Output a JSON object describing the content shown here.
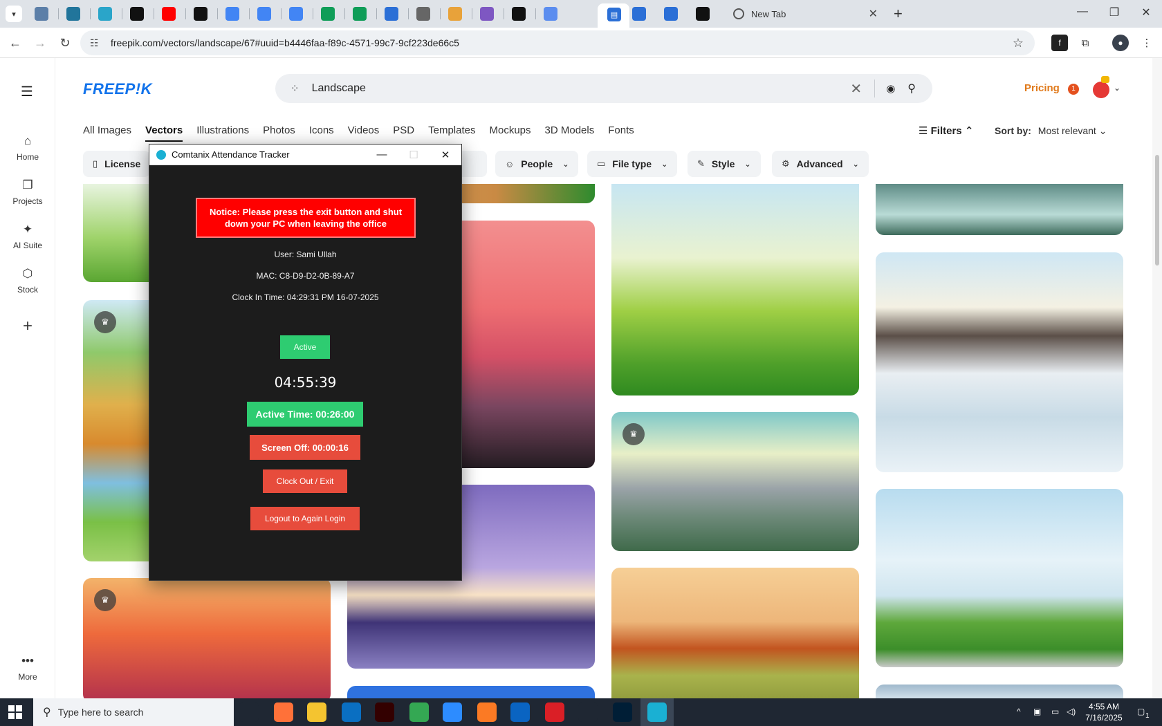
{
  "browser": {
    "new_tab_label": "New Tab",
    "url": "freepik.com/vectors/landscape/67#uuid=b4446faa-f89c-4571-99c7-9cf223de66c5",
    "tab_favicons": [
      {
        "icon": "globe-icon",
        "color": "#5c7fa8"
      },
      {
        "icon": "wordpress-icon",
        "color": "#21759b"
      },
      {
        "icon": "circle-app-icon",
        "color": "#2aa5c9"
      },
      {
        "icon": "openai-icon",
        "color": "#111111"
      },
      {
        "icon": "youtube-icon",
        "color": "#ff0000"
      },
      {
        "icon": "bolt-icon",
        "color": "#111111"
      },
      {
        "icon": "docs-icon",
        "color": "#4285f4"
      },
      {
        "icon": "docs-icon",
        "color": "#4285f4"
      },
      {
        "icon": "docs-icon",
        "color": "#4285f4"
      },
      {
        "icon": "sheets-icon",
        "color": "#0f9d58"
      },
      {
        "icon": "sheets-icon",
        "color": "#0f9d58"
      },
      {
        "icon": "chart-icon",
        "color": "#2b6fd6"
      },
      {
        "icon": "globe-icon",
        "color": "#666666"
      },
      {
        "icon": "pen-icon",
        "color": "#e8a23a"
      },
      {
        "icon": "code-icon",
        "color": "#7e57c2"
      },
      {
        "icon": "a-icon",
        "color": "#111111"
      },
      {
        "icon": "grid-icon",
        "color": "#5b8def"
      },
      {
        "icon": "forms-icon",
        "color": "#2b6fd6"
      },
      {
        "icon": "forms-icon",
        "color": "#2b6fd6"
      },
      {
        "icon": "forms-icon",
        "color": "#2b6fd6"
      },
      {
        "icon": "m-icon",
        "color": "#111111"
      },
      {
        "icon": "forms-icon",
        "color": "#2b6fd6"
      }
    ]
  },
  "freepik": {
    "logo": "FREEP!K",
    "search_query": "Landscape",
    "pricing": "Pricing",
    "notification_count": "1",
    "left_nav": [
      {
        "label": "Home",
        "icon": "home-icon"
      },
      {
        "label": "Projects",
        "icon": "projects-icon"
      },
      {
        "label": "AI Suite",
        "icon": "sparkle-icon"
      },
      {
        "label": "Stock",
        "icon": "stock-icon"
      }
    ],
    "more_label": "More",
    "categories": [
      "All Images",
      "Vectors",
      "Illustrations",
      "Photos",
      "Icons",
      "Videos",
      "PSD",
      "Templates",
      "Mockups",
      "3D Models",
      "Fonts"
    ],
    "selected_category": "Vectors",
    "filters_label": "Filters",
    "sort_label": "Sort by:",
    "sort_value": "Most relevant",
    "chips": {
      "license": "License",
      "people": "People",
      "file_type": "File type",
      "style": "Style",
      "advanced": "Advanced"
    }
  },
  "attendance": {
    "title": "Comtanix Attendance Tracker",
    "notice": "Notice: Please press the exit button and shut down your PC when leaving the office",
    "user": "User: Sami Ullah",
    "mac": "MAC: C8-D9-D2-0B-89-A7",
    "clock_in": "Clock In Time: 04:29:31 PM 16-07-2025",
    "status": "Active",
    "clock": "04:55:39",
    "active_time": "Active Time: 00:26:00",
    "screen_off": "Screen Off: 00:00:16",
    "clock_out": "Clock Out / Exit",
    "logout": "Logout to Again Login"
  },
  "taskbar": {
    "search_placeholder": "Type here to search",
    "time": "4:55 AM",
    "date": "7/16/2025",
    "notification_count": "1",
    "apps": [
      {
        "icon": "task-view-icon",
        "color": "#1f2733"
      },
      {
        "icon": "firefox-icon",
        "color": "#ff7139"
      },
      {
        "icon": "file-explorer-icon",
        "color": "#f4c430"
      },
      {
        "icon": "vscode-icon",
        "color": "#0a6fc2"
      },
      {
        "icon": "illustrator-icon",
        "color": "#330000"
      },
      {
        "icon": "chrome-icon",
        "color": "#34a853"
      },
      {
        "icon": "zoom-icon",
        "color": "#2d8cff"
      },
      {
        "icon": "xampp-icon",
        "color": "#fb7a24"
      },
      {
        "icon": "outlook-icon",
        "color": "#0a64c2"
      },
      {
        "icon": "creative-cloud-icon",
        "color": "#da1f26"
      },
      {
        "icon": "pen-tool-icon",
        "color": "#1f2733"
      },
      {
        "icon": "photoshop-icon",
        "color": "#001e36"
      },
      {
        "icon": "comtanix-icon",
        "color": "#1ab0d3"
      }
    ]
  }
}
